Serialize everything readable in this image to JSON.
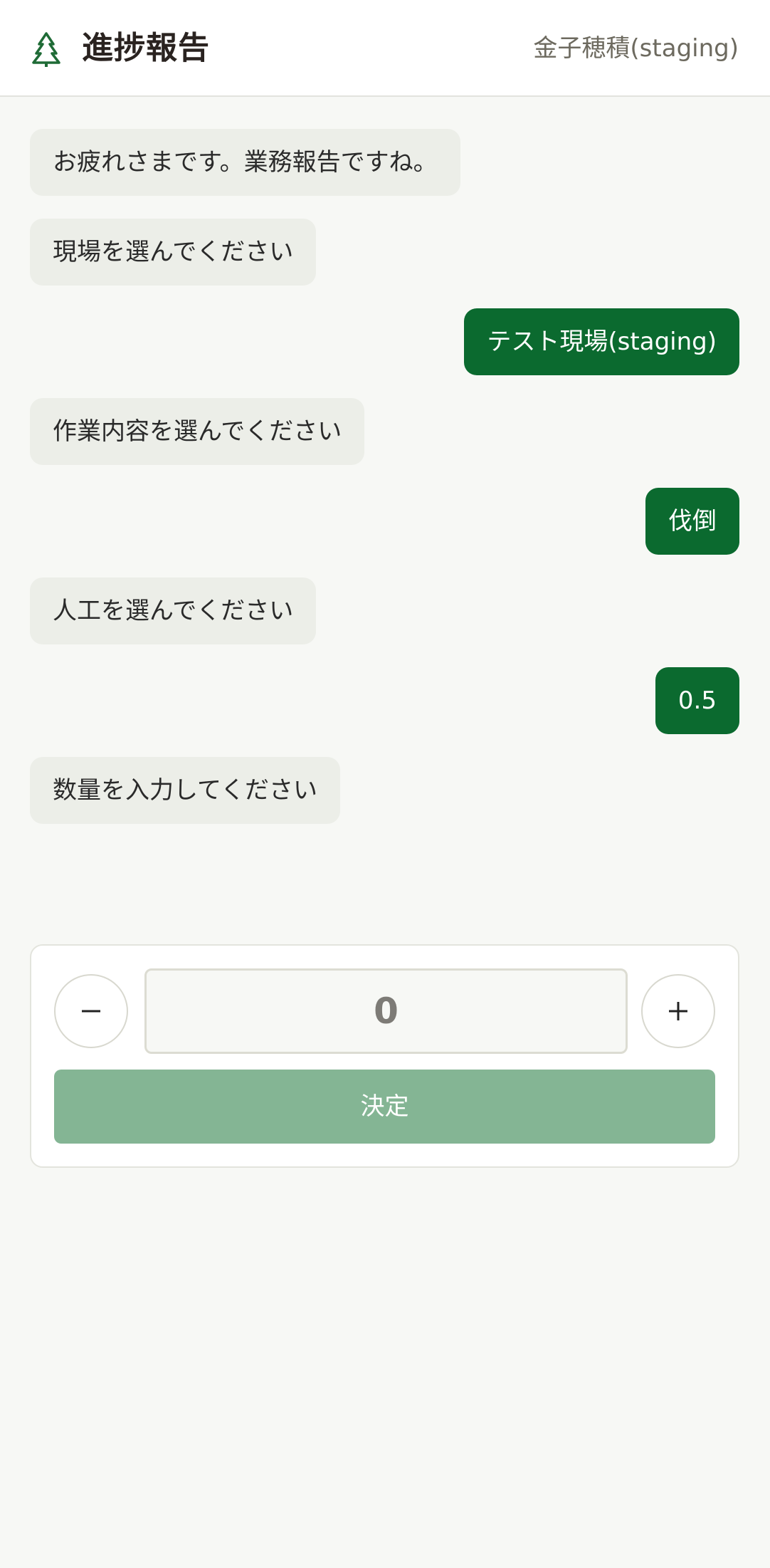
{
  "header": {
    "title": "進捗報告",
    "user": "金子穂積(staging)",
    "logo_icon": "tree-icon"
  },
  "messages": [
    {
      "role": "system",
      "text": "お疲れさまです。業務報告ですね。"
    },
    {
      "role": "system",
      "text": "現場を選んでください"
    },
    {
      "role": "user",
      "text": "テスト現場(staging)"
    },
    {
      "role": "system",
      "text": "作業内容を選んでください"
    },
    {
      "role": "user",
      "text": "伐倒"
    },
    {
      "role": "system",
      "text": "人工を選んでください"
    },
    {
      "role": "user",
      "text": "0.5"
    },
    {
      "role": "system",
      "text": "数量を入力してください"
    }
  ],
  "quantity": {
    "value": "0",
    "minus_icon": "minus-icon",
    "plus_icon": "plus-icon",
    "submit_label": "決定"
  },
  "colors": {
    "accent": "#0b6a2f",
    "button_disabled": "#84b594",
    "system_bubble": "#eceee8",
    "background": "#f7f8f5"
  }
}
